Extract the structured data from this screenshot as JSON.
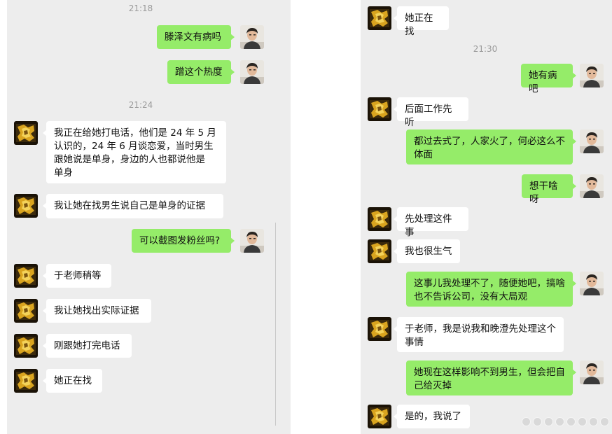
{
  "left": {
    "time_top": "21:18",
    "time_mid": "21:24",
    "messages": [
      {
        "text": "滕泽文有病吗"
      },
      {
        "text": "蹭这个热度"
      },
      {
        "text": "我正在给她打电话，他们是 24 年 5 月\n认识的，24 年 6 月谈恋爱，当时男生\n跟她说是单身，身边的人也都说他是\n单身"
      },
      {
        "text": "我让她在找男生说自己是单身的证据"
      },
      {
        "text": "可以截图发粉丝吗?"
      },
      {
        "text": "于老师稍等"
      },
      {
        "text": "我让她找出实际证据"
      },
      {
        "text": "刚跟她打完电话"
      },
      {
        "text": "她正在找"
      }
    ]
  },
  "right": {
    "time_mid": "21:30",
    "messages": [
      {
        "text": "她正在找"
      },
      {
        "text": "她有病吧"
      },
      {
        "text": "后面工作先听"
      },
      {
        "text": "都过去式了，人家火了，何必这么不\n体面"
      },
      {
        "text": "想干啥呀"
      },
      {
        "text": "先处理这件事"
      },
      {
        "text": "我也很生气"
      },
      {
        "text": "这事儿我处理不了，随便她吧，搞啥\n也不告诉公司，没有大局观"
      },
      {
        "text": "于老师，我是说我和晚澄先处理这个\n事情"
      },
      {
        "text": "她现在这样影响不到男生，但会把自\n己给灭掉"
      },
      {
        "text": "是的，我说了"
      }
    ]
  },
  "colors": {
    "outgoing_bubble": "#95ec69",
    "incoming_bubble": "#ffffff",
    "chat_bg": "#ededed"
  }
}
